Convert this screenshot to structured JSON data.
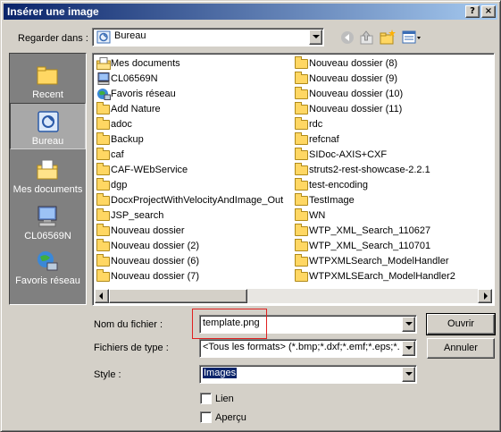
{
  "window": {
    "title": "Insérer une image",
    "help_button": "?",
    "close_button": "×"
  },
  "lookin": {
    "label": "Regarder dans :",
    "value": "Bureau"
  },
  "toolbar": {
    "icons": [
      "back-icon",
      "up-folder-icon",
      "new-folder-icon",
      "view-menu-icon"
    ]
  },
  "places": [
    {
      "label": "Recent",
      "icon": "recent-folder-icon"
    },
    {
      "label": "Bureau",
      "icon": "desktop-icon"
    },
    {
      "label": "Mes documents",
      "icon": "my-documents-icon"
    },
    {
      "label": "CL06569N",
      "icon": "computer-icon"
    },
    {
      "label": "Favoris réseau",
      "icon": "network-icon"
    }
  ],
  "files": {
    "column1": [
      {
        "name": "Mes documents",
        "icon": "my-documents-icon"
      },
      {
        "name": "CL06569N",
        "icon": "computer-icon"
      },
      {
        "name": "Favoris réseau",
        "icon": "network-icon"
      },
      {
        "name": "Add Nature",
        "icon": "folder-icon"
      },
      {
        "name": "adoc",
        "icon": "folder-icon"
      },
      {
        "name": "Backup",
        "icon": "folder-icon"
      },
      {
        "name": "caf",
        "icon": "folder-icon"
      },
      {
        "name": "CAF-WEbService",
        "icon": "folder-icon"
      },
      {
        "name": "dgp",
        "icon": "folder-icon"
      },
      {
        "name": "DocxProjectWithVelocityAndImage_Out",
        "icon": "folder-icon"
      },
      {
        "name": "JSP_search",
        "icon": "folder-icon"
      },
      {
        "name": "Nouveau dossier",
        "icon": "folder-icon"
      },
      {
        "name": "Nouveau dossier (2)",
        "icon": "folder-icon"
      },
      {
        "name": "Nouveau dossier (6)",
        "icon": "folder-icon"
      },
      {
        "name": "Nouveau dossier (7)",
        "icon": "folder-icon"
      }
    ],
    "column2": [
      {
        "name": "Nouveau dossier (8)",
        "icon": "folder-icon"
      },
      {
        "name": "Nouveau dossier (9)",
        "icon": "folder-icon"
      },
      {
        "name": "Nouveau dossier (10)",
        "icon": "folder-icon"
      },
      {
        "name": "Nouveau dossier (11)",
        "icon": "folder-icon"
      },
      {
        "name": "rdc",
        "icon": "folder-icon"
      },
      {
        "name": "refcnaf",
        "icon": "folder-icon"
      },
      {
        "name": "SIDoc-AXIS+CXF",
        "icon": "folder-icon"
      },
      {
        "name": "struts2-rest-showcase-2.2.1",
        "icon": "folder-icon"
      },
      {
        "name": "test-encoding",
        "icon": "folder-icon"
      },
      {
        "name": "TestImage",
        "icon": "folder-icon"
      },
      {
        "name": "WN",
        "icon": "folder-icon"
      },
      {
        "name": "WTP_XML_Search_110627",
        "icon": "folder-icon"
      },
      {
        "name": "WTP_XML_Search_110701",
        "icon": "folder-icon"
      },
      {
        "name": "WTPXMLSearch_ModelHandler",
        "icon": "folder-icon"
      },
      {
        "name": "WTPXMLSEarch_ModelHandler2",
        "icon": "folder-icon"
      }
    ]
  },
  "form": {
    "filename_label": "Nom du fichier :",
    "filename_value": "template.png",
    "filetype_label": "Fichiers de type :",
    "filetype_value": "<Tous les formats> (*.bmp;*.dxf;*.emf;*.eps;*.gif;",
    "style_label": "Style :",
    "style_value": "Images",
    "link_label": "Lien",
    "preview_label": "Aperçu"
  },
  "buttons": {
    "open": "Ouvrir",
    "cancel": "Annuler"
  },
  "colors": {
    "titlebar_start": "#0a246a",
    "titlebar_end": "#a6caf0",
    "highlight_box": "#e02020",
    "selection": "#0a246a"
  }
}
